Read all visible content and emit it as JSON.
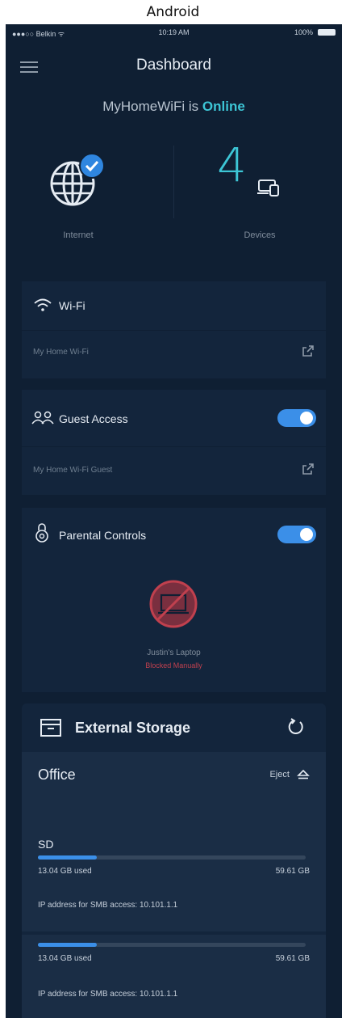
{
  "caption": "Android",
  "status_bar": {
    "carrier": "●●●○○ Belkin ᯤ",
    "time": "10:19 AM",
    "battery": "100%"
  },
  "header": {
    "title": "Dashboard"
  },
  "network": {
    "name_prefix": "MyHomeWiFi is ",
    "status": "Online"
  },
  "hero": {
    "internet_label": "Internet",
    "devices_count": "4",
    "devices_label": "Devices"
  },
  "wifi_card": {
    "title": "Wi-Fi",
    "network_name": "My Home Wi-Fi"
  },
  "guest_card": {
    "title": "Guest Access",
    "network_name": "My Home Wi-Fi Guest",
    "enabled": true
  },
  "parental_card": {
    "title": "Parental Controls",
    "enabled": true,
    "device_name": "Justin's Laptop",
    "device_status": "Blocked Manually"
  },
  "storage": {
    "title": "External Storage",
    "location": "Office",
    "eject_label": "Eject",
    "drives": [
      {
        "name": "SD",
        "used": "13.04 GB used",
        "total": "59.61 GB",
        "used_fraction": 0.22,
        "ip_text": "IP address for SMB access: 10.101.1.1"
      },
      {
        "name": "",
        "used": "13.04 GB used",
        "total": "59.61 GB",
        "used_fraction": 0.22,
        "ip_text": "IP address for SMB access: 10.101.1.1"
      }
    ]
  },
  "colors": {
    "accent": "#3dc6d6",
    "toggle": "#3b8fe8",
    "background": "#0f1f33",
    "card": "#13253c",
    "blocked": "#c0404e"
  },
  "icons": {
    "menu": "hamburger-icon",
    "internet": "globe-icon",
    "check": "check-badge-icon",
    "devices": "devices-icon",
    "wifi": "wifi-icon",
    "guest": "guest-people-icon",
    "parental": "lock-icon",
    "external": "external-link-icon",
    "blocked": "blocked-laptop-icon",
    "storage": "storage-box-icon",
    "refresh": "refresh-icon",
    "eject": "eject-icon"
  }
}
